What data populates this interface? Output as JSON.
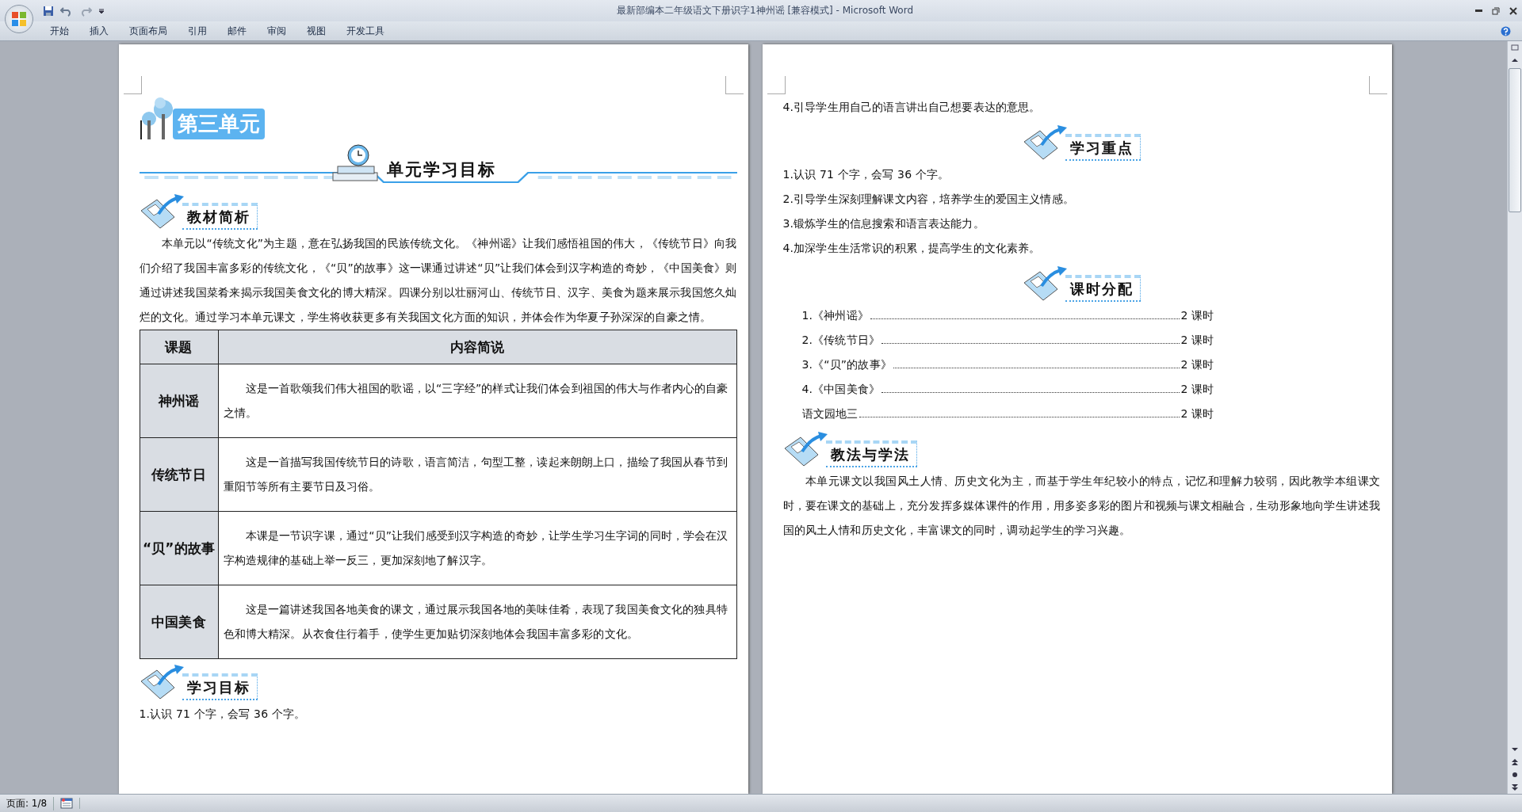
{
  "window": {
    "title": "最新部编本二年级语文下册识字1神州谣 [兼容模式] - Microsoft Word"
  },
  "ribbon_tabs": [
    "开始",
    "插入",
    "页面布局",
    "引用",
    "邮件",
    "审阅",
    "视图",
    "开发工具"
  ],
  "pages": [
    {
      "blocks": [
        {
          "kind": "unit_title",
          "text": "第三单元"
        },
        {
          "kind": "banner",
          "text": "单元学习目标"
        },
        {
          "kind": "heading",
          "text": "教材简析",
          "centered": false
        },
        {
          "kind": "paragraph",
          "text": "本单元以“传统文化”为主题，意在弘扬我国的民族传统文化。《神州谣》让我们感悟祖国的伟大，《传统节日》向我们介绍了我国丰富多彩的传统文化，《“贝”的故事》这一课通过讲述“贝”让我们体会到汉字构造的奇妙，《中国美食》则通过讲述我国菜肴来揭示我国美食文化的博大精深。四课分别以壮丽河山、传统节日、汉字、美食为题来展示我国悠久灿烂的文化。通过学习本单元课文，学生将收获更多有关我国文化方面的知识，并体会作为华夏子孙深深的自豪之情。"
        },
        {
          "kind": "table",
          "columns": [
            "课题",
            "内容简说"
          ],
          "rows": [
            {
              "title": "神州谣",
              "text": "这是一首歌颂我们伟大祖国的歌谣，以“三字经”的样式让我们体会到祖国的伟大与作者内心的自豪之情。"
            },
            {
              "title": "传统节日",
              "text": "这是一首描写我国传统节日的诗歌，语言简洁，句型工整，读起来朗朗上口，描绘了我国从春节到重阳节等所有主要节日及习俗。"
            },
            {
              "title": "“贝”的故事",
              "text": "本课是一节识字课，通过“贝”让我们感受到汉字构造的奇妙，让学生学习生字词的同时，学会在汉字构造规律的基础上举一反三，更加深刻地了解汉字。"
            },
            {
              "title": "中国美食",
              "text": "这是一篇讲述我国各地美食的课文，通过展示我国各地的美味佳肴，表现了我国美食文化的独具特色和博大精深。从衣食住行着手，使学生更加贴切深刻地体会我国丰富多彩的文化。"
            }
          ]
        },
        {
          "kind": "heading",
          "text": "学习目标",
          "centered": false
        },
        {
          "kind": "item",
          "text": "1.认识 71 个字，会写 36 个字。"
        }
      ]
    },
    {
      "blocks": [
        {
          "kind": "item",
          "text": "4.引导学生用自己的语言讲出自己想要表达的意思。"
        },
        {
          "kind": "heading",
          "text": "学习重点",
          "centered": true
        },
        {
          "kind": "item",
          "text": "1.认识 71 个字，会写 36 个字。"
        },
        {
          "kind": "item",
          "text": "2.引导学生深刻理解课文内容，培养学生的爱国主义情感。"
        },
        {
          "kind": "item",
          "text": "3.锻炼学生的信息搜索和语言表达能力。"
        },
        {
          "kind": "item",
          "text": "4.加深学生生活常识的积累，提高学生的文化素养。"
        },
        {
          "kind": "heading",
          "text": "课时分配",
          "centered": true
        },
        {
          "kind": "toc",
          "label": "1.《神州谣》",
          "value": "2 课时"
        },
        {
          "kind": "toc",
          "label": "2.《传统节日》",
          "value": "2 课时"
        },
        {
          "kind": "toc",
          "label": "3.《“贝”的故事》",
          "value": "2 课时"
        },
        {
          "kind": "toc",
          "label": "4.《中国美食》",
          "value": "2 课时"
        },
        {
          "kind": "toc",
          "label": "语文园地三",
          "value": "2 课时"
        },
        {
          "kind": "heading",
          "text": "教法与学法",
          "centered": false
        },
        {
          "kind": "paragraph",
          "text": "本单元课文以我国风土人情、历史文化为主，而基于学生年纪较小的特点，记忆和理解力较弱，因此教学本组课文时，要在课文的基础上，充分发挥多媒体课件的作用，用多姿多彩的图片和视频与课文相融合，生动形象地向学生讲述我国的风土人情和历史文化，丰富课文的同时，调动起学生的学习兴趣。"
        }
      ]
    }
  ],
  "status_bar": {
    "page": "页面: 1/8"
  }
}
